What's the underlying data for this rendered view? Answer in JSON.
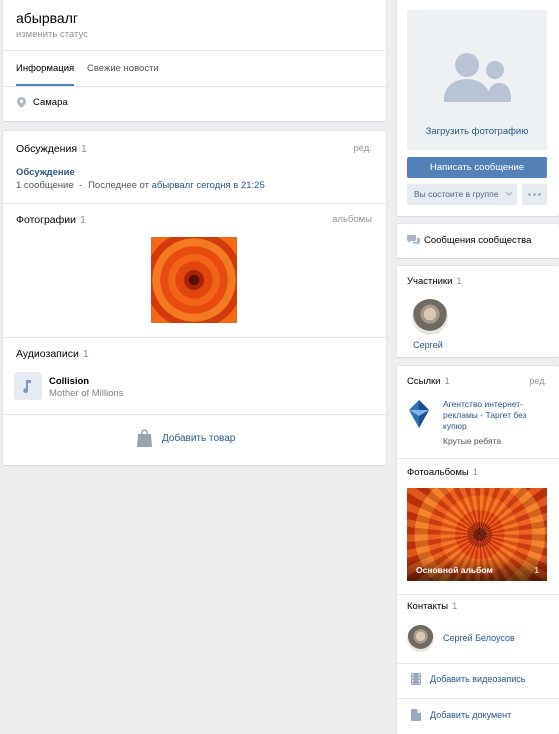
{
  "profile": {
    "name": "абырвалг",
    "status_placeholder": "изменить статус"
  },
  "tabs": [
    {
      "label": "Информация"
    },
    {
      "label": "Свежие новости"
    }
  ],
  "info": {
    "city": "Самара"
  },
  "discussions": {
    "title": "Обсуждения",
    "count": "1",
    "edit": "ред.",
    "topic": "Обсуждение",
    "meta_count": "1 сообщение",
    "meta_sep": "-",
    "meta_last": "Последнее от",
    "meta_author": "абырвалг",
    "meta_time": "сегодня в 21:25"
  },
  "photos": {
    "title": "Фотографии",
    "count": "1",
    "albums_link": "альбомы"
  },
  "audio": {
    "title": "Аудиозаписи",
    "count": "1",
    "track": {
      "title": "Collision",
      "artist": "Mother of Millions"
    }
  },
  "market": {
    "add_label": "Добавить товар"
  },
  "side": {
    "upload_photo": "Загрузить фотографию",
    "write_message": "Написать сообщение",
    "membership": "Вы состоите в группе",
    "community_messages": "Сообщения сообщества",
    "members": {
      "title": "Участники",
      "count": "1",
      "items": [
        {
          "name": "Сергей"
        }
      ]
    },
    "links": {
      "title": "Ссылки",
      "count": "1",
      "edit": "ред.",
      "item": {
        "title_line1": "Агентство интернет-",
        "title_line2": "рекламы - Таргет без",
        "title_line3": "купюр",
        "desc": "Крутые ребята"
      }
    },
    "albums": {
      "title": "Фотоальбомы",
      "count": "1",
      "album_name": "Основной альбом",
      "album_count": "1"
    },
    "contacts": {
      "title": "Контакты",
      "count": "1",
      "items": [
        {
          "name": "Сергей Белоусов"
        }
      ]
    },
    "add_video": "Добавить видеозапись",
    "add_document": "Добавить документ"
  },
  "colors": {
    "accent": "#5181b8",
    "link": "#2a5885",
    "background": "#edeef0",
    "button_secondary": "#e5ebf1"
  }
}
